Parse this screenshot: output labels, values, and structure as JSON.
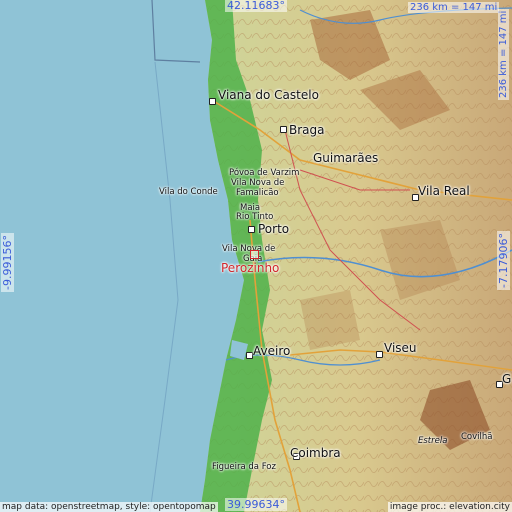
{
  "coordinates": {
    "north": "42.11683°",
    "south": "39.99634°",
    "west": "-9.99156°",
    "east": "-7.17906°"
  },
  "scale": {
    "top": "236 km = 147 mi",
    "right": "236 km = 147 mi"
  },
  "focus_place": "Perozinho",
  "places": {
    "viana": "Viana do Castelo",
    "braga": "Braga",
    "guimaraes": "Guimarães",
    "povoa": "Póvoa de Varzim",
    "vila_conde": "Vila do Conde",
    "famalicao_1": "Vila Nova de",
    "famalicao_2": "Famalicão",
    "maia": "Maia",
    "rio_tinto": "Rio Tinto",
    "porto": "Porto",
    "vng_1": "Vila Nova de",
    "vng_2": "Gaia",
    "vila_real": "Vila Real",
    "aveiro": "Aveiro",
    "viseu": "Viseu",
    "estrela": "Estrela",
    "covilha": "Covilhã",
    "figueira": "Figueira da Foz",
    "coimbra": "Coimbra",
    "g_edge": "G"
  },
  "credits": {
    "left": "map data: openstreetmap, style: opentopomap",
    "right": "image proc.: elevation.city"
  },
  "colors": {
    "sea": "#8fc3d6",
    "lowland": "#4fb24a",
    "hills": "#d8c98a",
    "mountains": "#a86a3c",
    "focus": "#d1262b",
    "coords": "#3a5bd9"
  }
}
